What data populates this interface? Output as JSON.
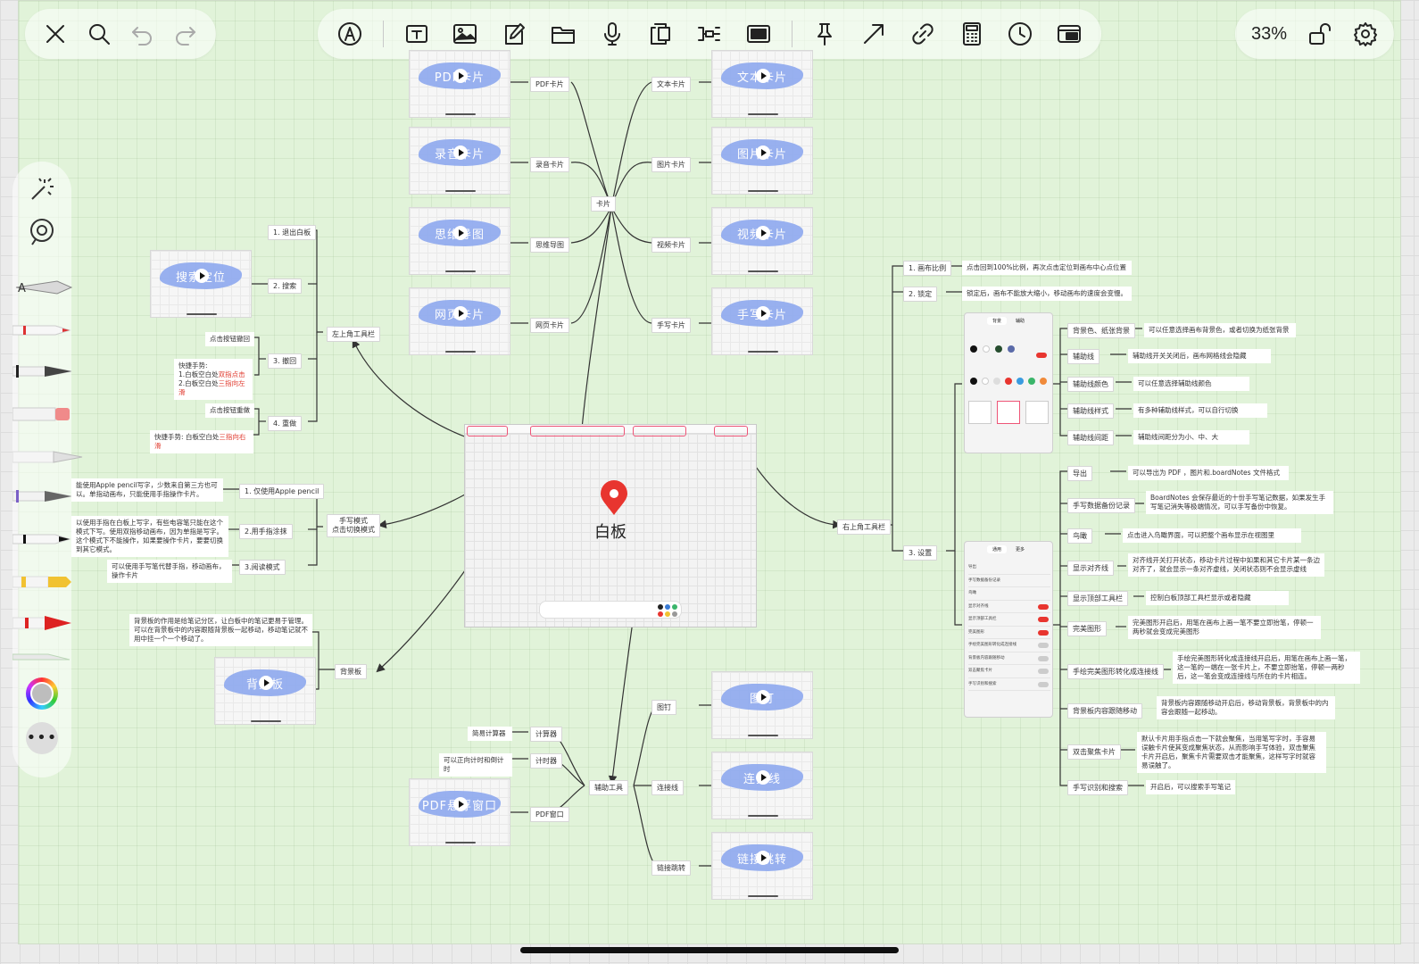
{
  "toolbar": {
    "zoom": "33%",
    "left_tools": [
      "close-icon",
      "search-icon",
      "undo-icon",
      "redo-icon"
    ],
    "center_tools": [
      "pen-mode-icon",
      "text-icon",
      "image-icon",
      "note-icon",
      "folder-icon",
      "microphone-icon",
      "pdf-icon",
      "mindmap-icon",
      "screen-icon",
      "pin-icon",
      "arrow-icon",
      "link-icon",
      "calculator-icon",
      "clock-icon",
      "window-icon"
    ],
    "right_tools": [
      "lock-icon",
      "settings-icon"
    ]
  },
  "center": {
    "title": "白板",
    "pin_color": "#e8352f"
  },
  "cards": {
    "hub": "卡片",
    "left": [
      "PDF卡片",
      "录音卡片",
      "思维导图",
      "网页卡片"
    ],
    "right": [
      "文本卡片",
      "图片卡片",
      "视频卡片",
      "手写卡片"
    ],
    "thumb_left": [
      "PDF卡片",
      "录音卡片",
      "思维导图",
      "网页卡片"
    ],
    "thumb_right": [
      "文本卡片",
      "图片卡片",
      "视频卡片",
      "手写卡片"
    ]
  },
  "top_left": {
    "hub": "左上角工具栏",
    "items": [
      "1. 退出白板",
      "2. 搜索",
      "3. 撤回",
      "4. 重做"
    ],
    "thumb": "搜索定位",
    "undo_hint": "点击按钮撤回",
    "undo_tip_title": "快捷手势:",
    "undo_tip_1": "1.白板空白处",
    "undo_tip_1_red": "双指点击",
    "undo_tip_2": "2.白板空白处",
    "undo_tip_2_red": "三指向左滑",
    "redo_hint": "点击按钮重做",
    "redo_tip": "快捷手势: 白板空白处",
    "redo_tip_red": "三指向右滑"
  },
  "handwriting": {
    "hub": "手写模式",
    "hub2": "点击切换模式",
    "items": [
      "1. 仅使用Apple pencil",
      "2.用手指涂抹",
      "3.阅读模式"
    ],
    "notes": [
      "能使用Apple pencil写字，少数来自第三方也可以。单指动画布，只能使用手指操作卡片。",
      "以使用手指在白板上写字，有些电容笔只能在这个模式下写。使用双指移动画布，因为单指是写字。这个模式下不能操作，如果要操作卡片，要要切换到其它模式。",
      "可以使用手写笔代替手指，移动画布，操作卡片"
    ]
  },
  "background": {
    "hub": "背景板",
    "thumb": "背景板",
    "note": "背景板的作用是给笔记分区，让白板中的笔记更易于管理。可以在背景板中的内容跟随背景板一起移动，移动笔记就不用中挂一个一个移动了。"
  },
  "aux": {
    "hub": "辅助工具",
    "items_left": [
      "计算器",
      "计时器",
      "PDF窗口"
    ],
    "items_right": [
      "图钉",
      "连接线",
      "链接跳转"
    ],
    "notes_left": [
      "简易计算器",
      "可以正向计时和倒计时"
    ],
    "thumbs": [
      "图钉",
      "连接线",
      "链接跳转",
      "PDF悬浮窗口"
    ]
  },
  "top_right": {
    "hub": "右上角工具栏",
    "items": [
      "1. 画布比例",
      "2. 锁定",
      "3. 设置"
    ],
    "zoom_note": "点击回到100%比例，再次点击定位到画布中心点位置",
    "lock_note": "锁定后，画布不能放大缩小，移动画布的速度会变慢。",
    "bg_settings": [
      {
        "label": "背景色、纸张背景",
        "note": "可以任意选择画布背景色，或者切换为纸张背景"
      },
      {
        "label": "辅助线",
        "note": "辅助线开关关闭后，画布网格线会隐藏"
      },
      {
        "label": "辅助线颜色",
        "note": "可以任意选择辅助线颜色"
      },
      {
        "label": "辅助线样式",
        "note": "有多种辅助线样式，可以自行切换"
      },
      {
        "label": "辅助线间距",
        "note": "辅助线间距分为小、中、大"
      }
    ],
    "other_settings": [
      {
        "label": "导出",
        "note": "可以导出为 PDF ，图片和.boardNotes 文件格式"
      },
      {
        "label": "手写数据备份记录",
        "note": "BoardNotes 会保存最近的十份手写笔记数据，如果发生手写笔记消失等极端情况，可以手写备份中恢复。"
      },
      {
        "label": "鸟瞰",
        "note": "点击进入鸟瞰界面，可以把整个画布显示在视图里"
      },
      {
        "label": "显示对齐线",
        "note": "对齐线开关打开状态，移动卡片过程中如果和其它卡片某一条边对齐了，就会显示一条对齐虚线，关闭状态则不会显示虚线"
      },
      {
        "label": "显示顶部工具栏",
        "note": "控制白板顶部工具栏显示或者隐藏"
      },
      {
        "label": "完美图形",
        "note": "完美图形开启后，用笔在画布上画一笔不要立即抬笔，停顿一两秒就会变成完美图形"
      },
      {
        "label": "手绘完美图形转化成连接线",
        "note": "手绘完美图形转化成连接线开启后，用笔在画布上画一笔，这一笔的一端在一张卡片上，不要立即抬笔，停顿一两秒后，这一笔会变成连接线与所在的卡片相连。"
      },
      {
        "label": "背景板内容跟随移动",
        "note": "背景板内容跟随移动开启后，移动背景板，背景板中的内容会跟随一起移动。"
      },
      {
        "label": "双击聚焦卡片",
        "note": "默认卡片用手指点击一下就会聚焦，当用笔写字时，手容易误触卡片使其变成聚焦状态，从而影响手写体验，双击聚焦卡片开启后，聚焦卡片需要双击才能聚焦，这样写字时就容易误触了。"
      },
      {
        "label": "手写识别和搜索",
        "note": "开启后，可以搜索手写笔记"
      }
    ],
    "panel1_tabs": [
      "背景",
      "辅助"
    ],
    "panel2_tabs": [
      "通用",
      "更多"
    ],
    "panel2_rows": [
      "导出",
      "手写数据备份记录",
      "鸟瞰",
      "显示对齐线",
      "显示顶部工具栏",
      "完美图形",
      "手绘完美图形转化成连接线",
      "背景板内容跟随移动",
      "双击聚焦卡片",
      "手写识别和搜索"
    ]
  },
  "colors": {
    "board": "#e1f3d9",
    "accent_red": "#e8352f",
    "brush_blue": "#8ea9ef",
    "toggle_on": "#e8352f"
  }
}
